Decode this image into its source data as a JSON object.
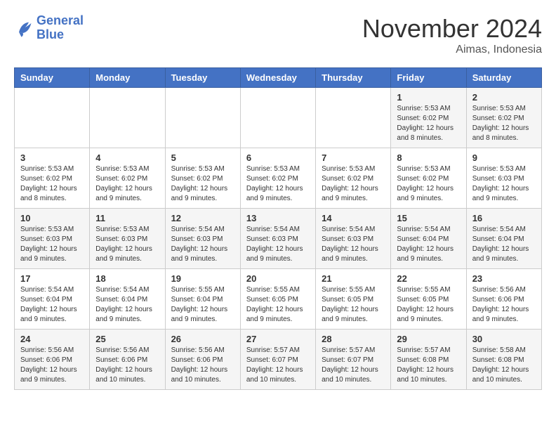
{
  "logo": {
    "line1": "General",
    "line2": "Blue"
  },
  "header": {
    "month": "November 2024",
    "location": "Aimas, Indonesia"
  },
  "weekdays": [
    "Sunday",
    "Monday",
    "Tuesday",
    "Wednesday",
    "Thursday",
    "Friday",
    "Saturday"
  ],
  "weeks": [
    [
      {
        "day": "",
        "info": ""
      },
      {
        "day": "",
        "info": ""
      },
      {
        "day": "",
        "info": ""
      },
      {
        "day": "",
        "info": ""
      },
      {
        "day": "",
        "info": ""
      },
      {
        "day": "1",
        "info": "Sunrise: 5:53 AM\nSunset: 6:02 PM\nDaylight: 12 hours and 8 minutes."
      },
      {
        "day": "2",
        "info": "Sunrise: 5:53 AM\nSunset: 6:02 PM\nDaylight: 12 hours and 8 minutes."
      }
    ],
    [
      {
        "day": "3",
        "info": "Sunrise: 5:53 AM\nSunset: 6:02 PM\nDaylight: 12 hours and 8 minutes."
      },
      {
        "day": "4",
        "info": "Sunrise: 5:53 AM\nSunset: 6:02 PM\nDaylight: 12 hours and 9 minutes."
      },
      {
        "day": "5",
        "info": "Sunrise: 5:53 AM\nSunset: 6:02 PM\nDaylight: 12 hours and 9 minutes."
      },
      {
        "day": "6",
        "info": "Sunrise: 5:53 AM\nSunset: 6:02 PM\nDaylight: 12 hours and 9 minutes."
      },
      {
        "day": "7",
        "info": "Sunrise: 5:53 AM\nSunset: 6:02 PM\nDaylight: 12 hours and 9 minutes."
      },
      {
        "day": "8",
        "info": "Sunrise: 5:53 AM\nSunset: 6:02 PM\nDaylight: 12 hours and 9 minutes."
      },
      {
        "day": "9",
        "info": "Sunrise: 5:53 AM\nSunset: 6:03 PM\nDaylight: 12 hours and 9 minutes."
      }
    ],
    [
      {
        "day": "10",
        "info": "Sunrise: 5:53 AM\nSunset: 6:03 PM\nDaylight: 12 hours and 9 minutes."
      },
      {
        "day": "11",
        "info": "Sunrise: 5:53 AM\nSunset: 6:03 PM\nDaylight: 12 hours and 9 minutes."
      },
      {
        "day": "12",
        "info": "Sunrise: 5:54 AM\nSunset: 6:03 PM\nDaylight: 12 hours and 9 minutes."
      },
      {
        "day": "13",
        "info": "Sunrise: 5:54 AM\nSunset: 6:03 PM\nDaylight: 12 hours and 9 minutes."
      },
      {
        "day": "14",
        "info": "Sunrise: 5:54 AM\nSunset: 6:03 PM\nDaylight: 12 hours and 9 minutes."
      },
      {
        "day": "15",
        "info": "Sunrise: 5:54 AM\nSunset: 6:04 PM\nDaylight: 12 hours and 9 minutes."
      },
      {
        "day": "16",
        "info": "Sunrise: 5:54 AM\nSunset: 6:04 PM\nDaylight: 12 hours and 9 minutes."
      }
    ],
    [
      {
        "day": "17",
        "info": "Sunrise: 5:54 AM\nSunset: 6:04 PM\nDaylight: 12 hours and 9 minutes."
      },
      {
        "day": "18",
        "info": "Sunrise: 5:54 AM\nSunset: 6:04 PM\nDaylight: 12 hours and 9 minutes."
      },
      {
        "day": "19",
        "info": "Sunrise: 5:55 AM\nSunset: 6:04 PM\nDaylight: 12 hours and 9 minutes."
      },
      {
        "day": "20",
        "info": "Sunrise: 5:55 AM\nSunset: 6:05 PM\nDaylight: 12 hours and 9 minutes."
      },
      {
        "day": "21",
        "info": "Sunrise: 5:55 AM\nSunset: 6:05 PM\nDaylight: 12 hours and 9 minutes."
      },
      {
        "day": "22",
        "info": "Sunrise: 5:55 AM\nSunset: 6:05 PM\nDaylight: 12 hours and 9 minutes."
      },
      {
        "day": "23",
        "info": "Sunrise: 5:56 AM\nSunset: 6:06 PM\nDaylight: 12 hours and 9 minutes."
      }
    ],
    [
      {
        "day": "24",
        "info": "Sunrise: 5:56 AM\nSunset: 6:06 PM\nDaylight: 12 hours and 9 minutes."
      },
      {
        "day": "25",
        "info": "Sunrise: 5:56 AM\nSunset: 6:06 PM\nDaylight: 12 hours and 10 minutes."
      },
      {
        "day": "26",
        "info": "Sunrise: 5:56 AM\nSunset: 6:06 PM\nDaylight: 12 hours and 10 minutes."
      },
      {
        "day": "27",
        "info": "Sunrise: 5:57 AM\nSunset: 6:07 PM\nDaylight: 12 hours and 10 minutes."
      },
      {
        "day": "28",
        "info": "Sunrise: 5:57 AM\nSunset: 6:07 PM\nDaylight: 12 hours and 10 minutes."
      },
      {
        "day": "29",
        "info": "Sunrise: 5:57 AM\nSunset: 6:08 PM\nDaylight: 12 hours and 10 minutes."
      },
      {
        "day": "30",
        "info": "Sunrise: 5:58 AM\nSunset: 6:08 PM\nDaylight: 12 hours and 10 minutes."
      }
    ]
  ]
}
